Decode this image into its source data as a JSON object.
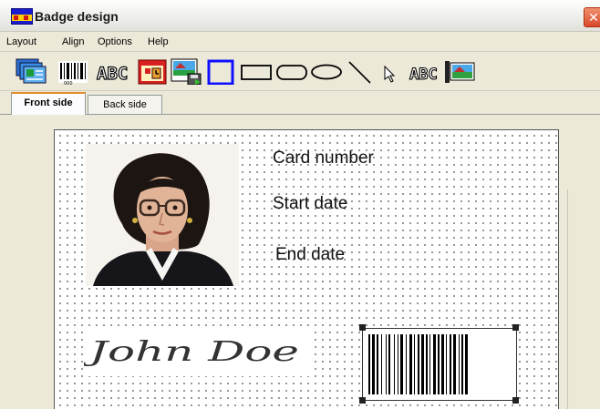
{
  "window": {
    "title": "Badge design",
    "close_glyph": "✕"
  },
  "menu": {
    "items": [
      "Layout",
      "Align",
      "Options",
      "Help"
    ]
  },
  "toolbar": {
    "tools": [
      "cards-icon",
      "barcode-icon",
      "text-icon",
      "date-icon",
      "image-save-icon",
      "rectangle-icon",
      "rounded-rectangle-icon",
      "pill-icon",
      "ellipse-icon",
      "line-icon",
      "pointer-icon",
      "text-field-icon",
      "image-field-icon"
    ],
    "text_tool_glyph": "ABC"
  },
  "tabs": {
    "front": "Front side",
    "back": "Back side"
  },
  "card": {
    "fields": {
      "card_number": "Card number",
      "start_date": "Start date",
      "end_date": "End date"
    },
    "signature_text": "John Doe"
  },
  "colors": {
    "selected_tool_border": "#1010ff",
    "tab_accent": "#e68b2c"
  }
}
